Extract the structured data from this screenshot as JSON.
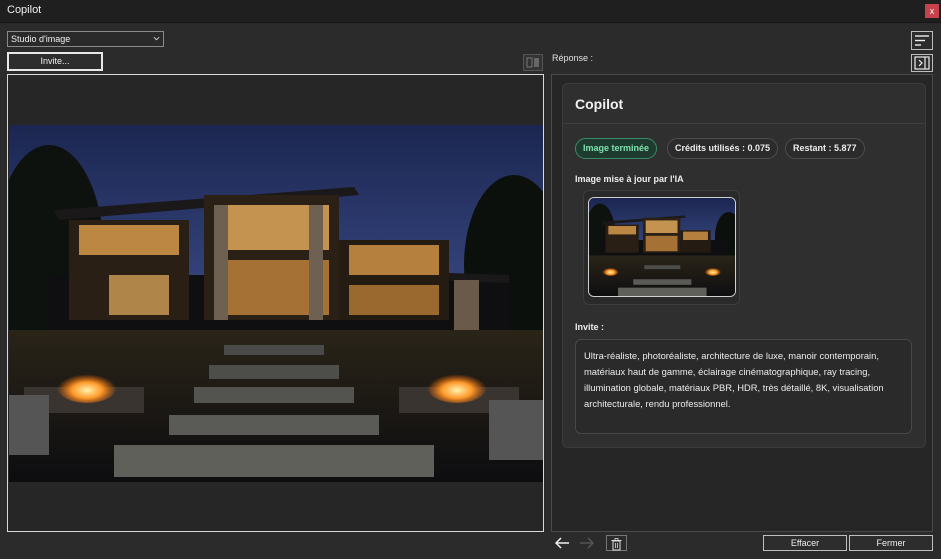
{
  "window": {
    "title": "Copilot",
    "close_label": "x"
  },
  "toolbar": {
    "mode_select": "Studio d'image",
    "invite_button": "Invite...",
    "reponse_label": "Réponse :"
  },
  "card": {
    "title": "Copilot",
    "badges": {
      "status": "Image terminée",
      "credits": "Crédits utilisés : 0.075",
      "remaining": "Restant : 5.877"
    },
    "image_label": "Image mise à jour par l'IA",
    "invite_label": "Invite :",
    "prompt_text": "Ultra-réaliste, photoréaliste, architecture de luxe, manoir contemporain, matériaux haut de gamme, éclairage cinématographique, ray tracing, illumination globale, matériaux PBR, HDR, très détaillé, 8K, visualisation architecturale, rendu professionnel."
  },
  "footer": {
    "clear_button": "Effacer",
    "close_button": "Fermer"
  },
  "icons": {
    "back": "arrow-left-icon",
    "forward": "arrow-right-icon",
    "delete": "trash-icon",
    "menu": "sort-lines-icon",
    "panel": "panel-toggle-icon",
    "compare": "compare-icon"
  },
  "colors": {
    "accent_green": "#3a8c66",
    "close_red": "#c9414a"
  }
}
